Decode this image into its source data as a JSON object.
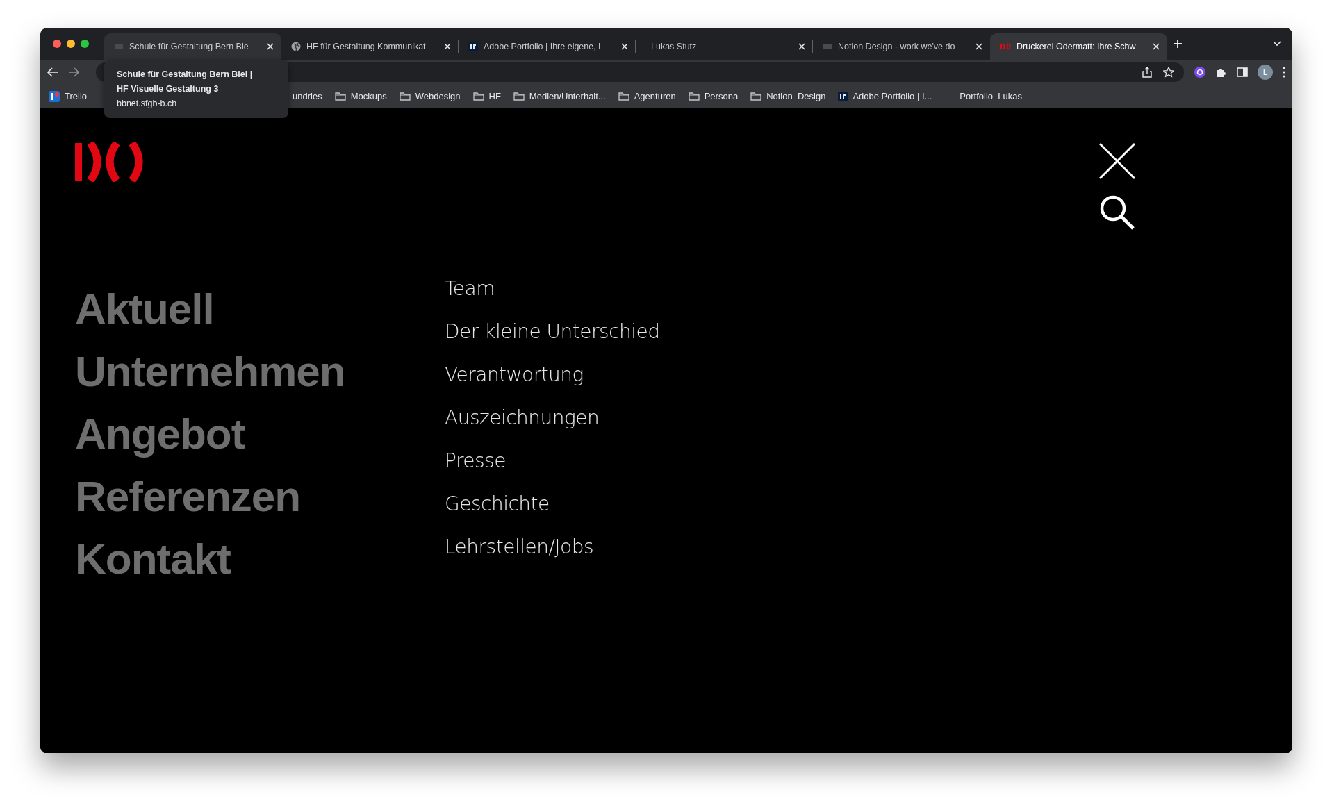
{
  "tabs": [
    {
      "title": "Schule für Gestaltung Bern Bie",
      "kind": "faint",
      "selected": false,
      "hovered": true
    },
    {
      "title": "HF für Gestaltung Kommunikat",
      "kind": "globe",
      "selected": false,
      "hovered": false
    },
    {
      "title": "Adobe Portfolio | Ihre eigene, i",
      "kind": "pf",
      "selected": false,
      "hovered": false
    },
    {
      "title": "Lukas Stutz",
      "kind": "none",
      "selected": false,
      "hovered": false
    },
    {
      "title": "Notion Design - work we've do",
      "kind": "faint",
      "selected": false,
      "hovered": false
    },
    {
      "title": "Druckerei Odermatt: Ihre Schw",
      "kind": "do",
      "selected": true,
      "hovered": false
    }
  ],
  "toolbar": {
    "profile_initial": "L"
  },
  "bookmarks": [
    {
      "label": "Trello",
      "kind": "trello"
    },
    {
      "label": "undries",
      "kind": "none"
    },
    {
      "label": "Mockups",
      "kind": "folder"
    },
    {
      "label": "Webdesign",
      "kind": "folder"
    },
    {
      "label": "HF",
      "kind": "folder"
    },
    {
      "label": "Medien/Unterhalt...",
      "kind": "folder"
    },
    {
      "label": "Agenturen",
      "kind": "folder"
    },
    {
      "label": "Persona",
      "kind": "folder"
    },
    {
      "label": "Notion_Design",
      "kind": "folder"
    },
    {
      "label": "Adobe Portfolio | I...",
      "kind": "pf"
    },
    {
      "label": "Portfolio_Lukas",
      "kind": "none"
    }
  ],
  "tooltip": {
    "lines": [
      "Schule für Gestaltung Bern Biel |",
      "HF Visuelle Gestaltung 3"
    ],
    "url": "bbnet.sfgb-b.ch"
  },
  "site": {
    "main_menu": [
      "Aktuell",
      "Unternehmen",
      "Angebot",
      "Referenzen",
      "Kontakt"
    ],
    "sub_menu": [
      "Team",
      "Der kleine Unterschied",
      "Verantwortung",
      "Auszeichnungen",
      "Presse",
      "Geschichte",
      "Lehrstellen/Jobs"
    ]
  }
}
